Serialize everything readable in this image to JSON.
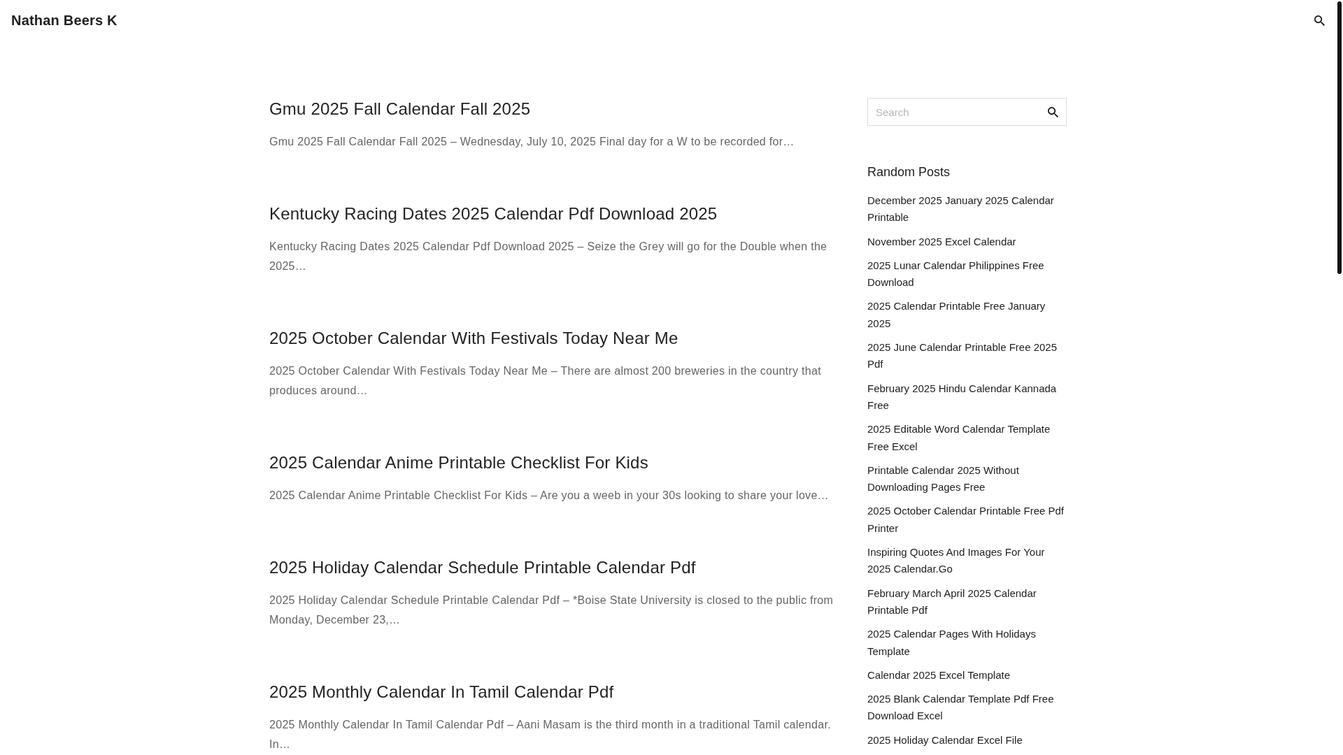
{
  "header": {
    "site_title": "Nathan Beers K"
  },
  "posts": [
    {
      "title": "Gmu 2025 Fall Calendar Fall 2025",
      "excerpt": "Gmu 2025 Fall Calendar Fall 2025 – Wednesday, July 10, 2025 Final day for a W to be recorded for…"
    },
    {
      "title": "Kentucky Racing Dates 2025 Calendar Pdf Download 2025",
      "excerpt": "Kentucky Racing Dates 2025 Calendar Pdf Download 2025 – Seize the Grey will go for the Double when the 2025…"
    },
    {
      "title": "2025 October Calendar With Festivals Today Near Me",
      "excerpt": "2025 October Calendar With Festivals Today Near Me – There are almost 200 breweries in the country that produces around…"
    },
    {
      "title": "2025 Calendar Anime Printable Checklist For Kids",
      "excerpt": "2025 Calendar Anime Printable Checklist For Kids – Are you a weeb in your 30s looking to share your love…"
    },
    {
      "title": "2025 Holiday Calendar Schedule Printable Calendar Pdf",
      "excerpt": "2025 Holiday Calendar Schedule Printable Calendar Pdf – *Boise State University is closed to the public from Monday, December 23,…"
    },
    {
      "title": "2025 Monthly Calendar In Tamil Calendar Pdf",
      "excerpt": "2025 Monthly Calendar In Tamil Calendar Pdf – Aani Masam is the third month in a traditional Tamil calendar. In…"
    }
  ],
  "sidebar": {
    "search": {
      "placeholder": "Search"
    },
    "random_posts": {
      "heading": "Random Posts",
      "items": [
        "December 2025 January 2025 Calendar Printable",
        "November 2025 Excel Calendar",
        "2025 Lunar Calendar Philippines Free Download",
        "2025 Calendar Printable Free January 2025",
        "2025 June Calendar Printable Free 2025 Pdf",
        "February 2025 Hindu Calendar Kannada Free",
        "2025 Editable Word Calendar Template Free Excel",
        "Printable Calendar 2025 Without Downloading Pages Free",
        "2025 October Calendar Printable Free Pdf Printer",
        "Inspiring Quotes And Images For Your 2025 Calendar.Go",
        "February March April 2025 Calendar Printable Pdf",
        "2025 Calendar Pages With Holidays Template",
        "Calendar 2025 Excel Template",
        "2025 Blank Calendar Template Pdf Free Download Excel",
        "2025 Holiday Calendar Excel File"
      ]
    }
  }
}
